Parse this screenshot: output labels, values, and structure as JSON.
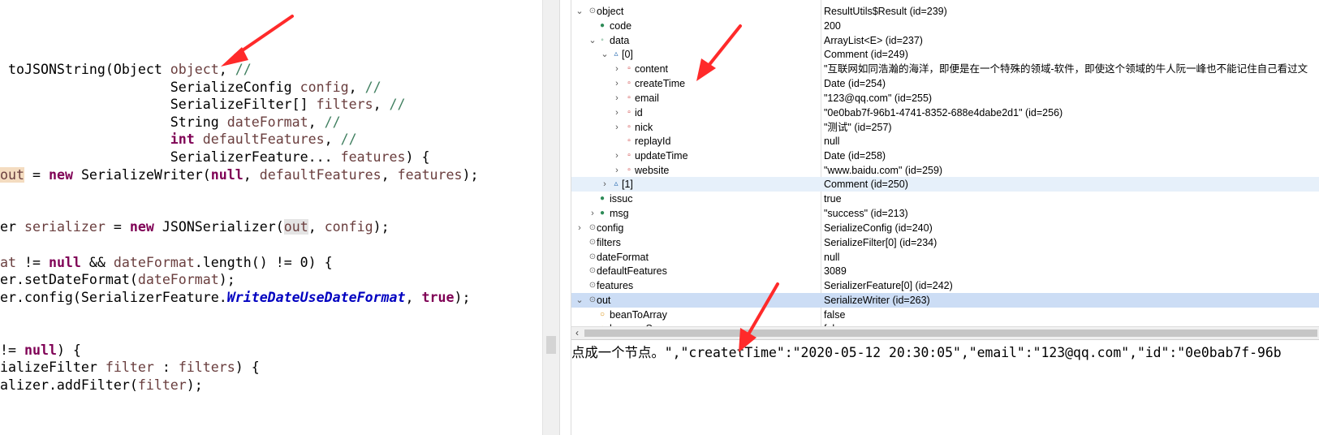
{
  "code": {
    "l1": {
      "a": " toJSONString(Object ",
      "b": "object",
      "c": ", ",
      "d": "//"
    },
    "l2": {
      "a": "                     SerializeConfig ",
      "b": "config",
      "c": ", ",
      "d": "//"
    },
    "l3": {
      "a": "                     SerializeFilter[] ",
      "b": "filters",
      "c": ", ",
      "d": "//"
    },
    "l4": {
      "a": "                     String ",
      "b": "dateFormat",
      "c": ", ",
      "d": "//"
    },
    "l5": {
      "a": "                     ",
      "k": "int",
      "a2": " ",
      "b": "defaultFeatures",
      "c": ", ",
      "d": "//"
    },
    "l6": {
      "a": "                     SerializerFeature... ",
      "b": "features",
      "c": ") {"
    },
    "l7": {
      "b": "out",
      "a": " = ",
      "k": "new",
      "a2": " SerializeWriter(",
      "k2": "null",
      "c": ", ",
      "b2": "defaultFeatures",
      "c2": ", ",
      "b3": "features",
      "c3": ");"
    },
    "l8": {
      "a": "er ",
      "b": "serializer",
      "c": " = ",
      "k": "new",
      "a2": " JSONSerializer(",
      "b2": "out",
      "c2": ", ",
      "b3": "config",
      "c3": ");"
    },
    "l9": {
      "b": "at",
      "a": " != ",
      "k": "null",
      "a2": " && ",
      "b2": "dateFormat",
      "c": ".length() != 0) {"
    },
    "l10": {
      "a": "er.setDateFormat(",
      "b": "dateFormat",
      "c": ");"
    },
    "l11": {
      "a": "er.config(SerializerFeature.",
      "cst": "WriteDateUseDateFormat",
      "c": ", ",
      "k": "true",
      "c2": ");"
    },
    "l12": {
      "a": "!= ",
      "k": "null",
      "c": ") {"
    },
    "l13": {
      "a": "ializeFilter ",
      "b": "filter",
      "c": " : ",
      "b2": "filters",
      "c2": ") {"
    },
    "l14": {
      "a": "alizer.addFilter(",
      "b": "filter",
      "c": ");"
    }
  },
  "variables": [
    {
      "name": "object",
      "value": "ResultUtils$Result  (id=239)"
    },
    {
      "name": "code",
      "value": "200"
    },
    {
      "name": "data",
      "value": "ArrayList<E>  (id=237)"
    },
    {
      "name": "[0]",
      "value": "Comment  (id=249)"
    },
    {
      "name": "content",
      "value": "\"互联网如同浩瀚的海洋，即便是在一个特殊的领域-软件，即使这个领域的牛人阮一峰也不能记住自己看过文"
    },
    {
      "name": "createTime",
      "value": "Date  (id=254)"
    },
    {
      "name": "email",
      "value": "\"123@qq.com\" (id=255)"
    },
    {
      "name": "id",
      "value": "\"0e0bab7f-96b1-4741-8352-688e4dabe2d1\" (id=256)"
    },
    {
      "name": "nick",
      "value": "\"测试\" (id=257)"
    },
    {
      "name": "replayId",
      "value": "null"
    },
    {
      "name": "updateTime",
      "value": "Date  (id=258)"
    },
    {
      "name": "website",
      "value": "\"www.baidu.com\" (id=259)"
    },
    {
      "name": "[1]",
      "value": "Comment  (id=250)"
    },
    {
      "name": "issuc",
      "value": "true"
    },
    {
      "name": "msg",
      "value": "\"success\" (id=213)"
    },
    {
      "name": "config",
      "value": "SerializeConfig  (id=240)"
    },
    {
      "name": "filters",
      "value": "SerializeFilter[0]  (id=234)"
    },
    {
      "name": "dateFormat",
      "value": "null"
    },
    {
      "name": "defaultFeatures",
      "value": "3089"
    },
    {
      "name": "features",
      "value": "SerializerFeature[0]  (id=242)"
    },
    {
      "name": "out",
      "value": "SerializeWriter  (id=263)"
    },
    {
      "name": "beanToArray",
      "value": "false"
    },
    {
      "name": "browserSecure",
      "value": "false"
    }
  ],
  "detail": {
    "text": "点成一个节点。\",\"createtTime\":\"2020-05-12 20:30:05\",\"email\":\"123@qq.com\",\"id\":\"0e0bab7f-96b"
  },
  "icons": {
    "field": "circle-icon",
    "expand": "chevron-right-icon",
    "collapse": "chevron-down-icon",
    "scroll_left": "chevron-left-icon",
    "annotation": "red-arrow-icon"
  },
  "colors": {
    "keyword": "#7f0055",
    "field": "#6a3e3e",
    "comment": "#3f7f5f",
    "constant": "#0000c0",
    "selection": "#ccddf5",
    "arrow": "#ff2a2a"
  }
}
